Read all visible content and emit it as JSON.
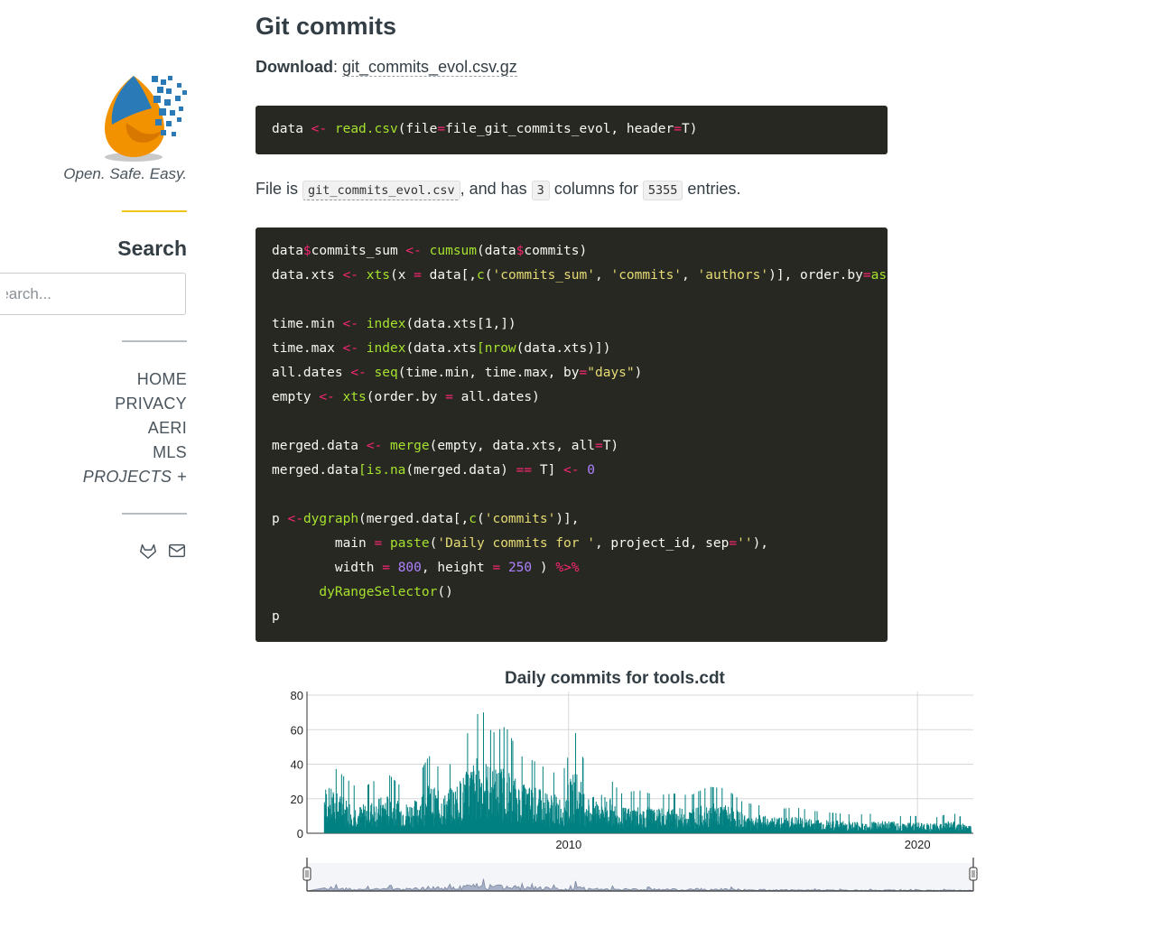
{
  "sidebar": {
    "tagline": "Open. Safe. Easy.",
    "search_title": "Search",
    "search_placeholder": "Search...",
    "nav": [
      "HOME",
      "PRIVACY",
      "AERI",
      "MLS",
      "PROJECTS"
    ],
    "projects_toggle": "+",
    "social_icons": [
      "gitlab-icon",
      "mail-icon"
    ],
    "colors": {
      "accent": "#f0c419",
      "logo_orange": "#f39200",
      "logo_blue": "#2a7ab8"
    }
  },
  "main": {
    "title": "Git commits",
    "download_label": "Download",
    "download_sep": ":",
    "download_file": "git_commits_evol.csv.gz",
    "file_is": "File is",
    "file_name": "git_commits_evol.csv",
    "and_has": ", and has",
    "num_columns": "3",
    "columns_for": "columns for",
    "num_entries": "5355",
    "entries": "entries."
  },
  "chart_data": {
    "type": "bar",
    "title": "Daily commits for tools.cdt",
    "xlabel": "",
    "ylabel": "",
    "ylim": [
      0,
      80
    ],
    "yticks": [
      0,
      20,
      40,
      60,
      80
    ],
    "xlim": [
      2002.5,
      2021.6
    ],
    "xticks": [
      2010,
      2020
    ],
    "grid": true,
    "range_selector": true,
    "color": "#008080",
    "series": [
      {
        "x": [
          2003.0,
          2003.5,
          2004.0,
          2004.4,
          2004.8,
          2005.2,
          2005.6,
          2006.0,
          2006.4,
          2006.8,
          2007.2,
          2007.5,
          2007.8,
          2008.2,
          2008.6,
          2009.0,
          2009.4,
          2009.8,
          2010.2,
          2010.6,
          2011.0,
          2011.5,
          2012.0,
          2012.5,
          2013.0,
          2013.5,
          2014.0,
          2014.5,
          2015.0,
          2015.5,
          2016.0,
          2016.5,
          2017.0,
          2017.5,
          2018.0,
          2018.5,
          2019.0,
          2019.5,
          2020.0,
          2020.5,
          2021.0,
          2021.5
        ],
        "values": [
          44,
          34,
          25,
          30,
          35,
          27,
          30,
          45,
          35,
          45,
          62,
          73,
          58,
          62,
          45,
          42,
          37,
          33,
          58,
          31,
          37,
          23,
          25,
          22,
          23,
          22,
          27,
          26,
          18,
          16,
          14,
          15,
          13,
          12,
          11,
          11,
          12,
          10,
          10,
          9,
          12,
          7
        ]
      }
    ]
  }
}
